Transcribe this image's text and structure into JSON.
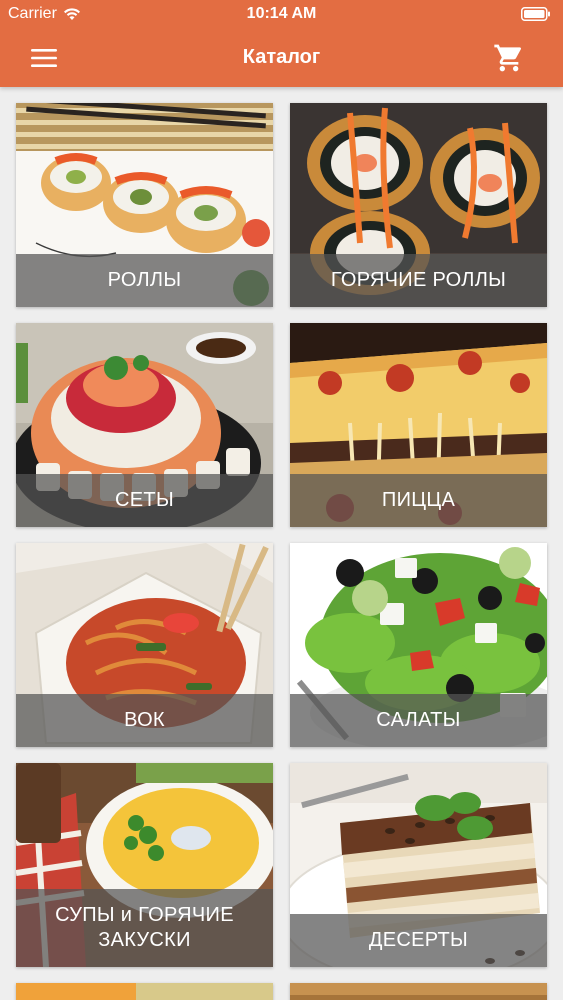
{
  "status_bar": {
    "carrier": "Carrier",
    "time": "10:14 AM"
  },
  "header": {
    "title": "Каталог",
    "menu_icon": "hamburger-menu-icon",
    "cart_icon": "shopping-cart-icon",
    "background_color": "#e36d42"
  },
  "catalog": {
    "items": [
      {
        "label": "РОЛЛЫ"
      },
      {
        "label": "ГОРЯЧИЕ РОЛЛЫ"
      },
      {
        "label": "СЕТЫ"
      },
      {
        "label": "ПИЦЦА"
      },
      {
        "label": "ВОК"
      },
      {
        "label": "САЛАТЫ"
      },
      {
        "label": "СУПЫ и ГОРЯЧИЕ ЗАКУСКИ"
      },
      {
        "label": "ДЕСЕРТЫ"
      }
    ]
  }
}
